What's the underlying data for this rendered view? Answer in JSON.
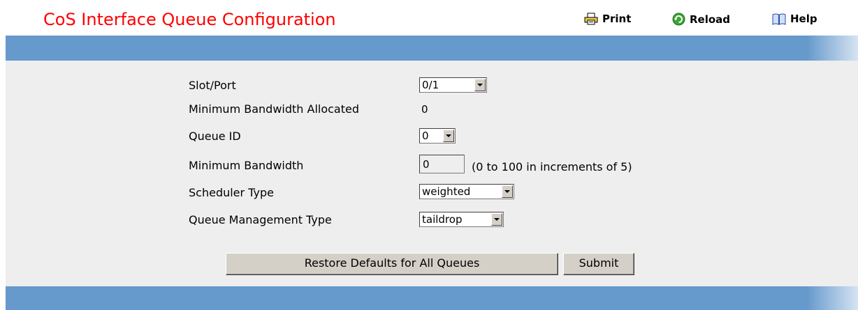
{
  "page": {
    "title": "CoS Interface Queue Configuration"
  },
  "toolbar": {
    "print_label": "Print",
    "reload_label": "Reload",
    "help_label": "Help"
  },
  "form": {
    "slot_port": {
      "label": "Slot/Port",
      "value": "0/1"
    },
    "min_bandwidth_allocated": {
      "label": "Minimum Bandwidth Allocated",
      "value": "0"
    },
    "queue_id": {
      "label": "Queue ID",
      "value": "0"
    },
    "min_bandwidth": {
      "label": "Minimum Bandwidth",
      "value": "0",
      "hint": "(0 to 100 in increments of 5)"
    },
    "scheduler_type": {
      "label": "Scheduler Type",
      "value": "weighted"
    },
    "queue_mgmt_type": {
      "label": "Queue Management Type",
      "value": "taildrop"
    }
  },
  "buttons": {
    "restore_label": "Restore Defaults for All Queues",
    "submit_label": "Submit"
  },
  "colors": {
    "title": "#ff0000",
    "bar": "#6699cc",
    "panel": "#eeeeee"
  },
  "icons": {
    "print": "printer-icon",
    "reload": "reload-icon",
    "help": "book-icon"
  }
}
